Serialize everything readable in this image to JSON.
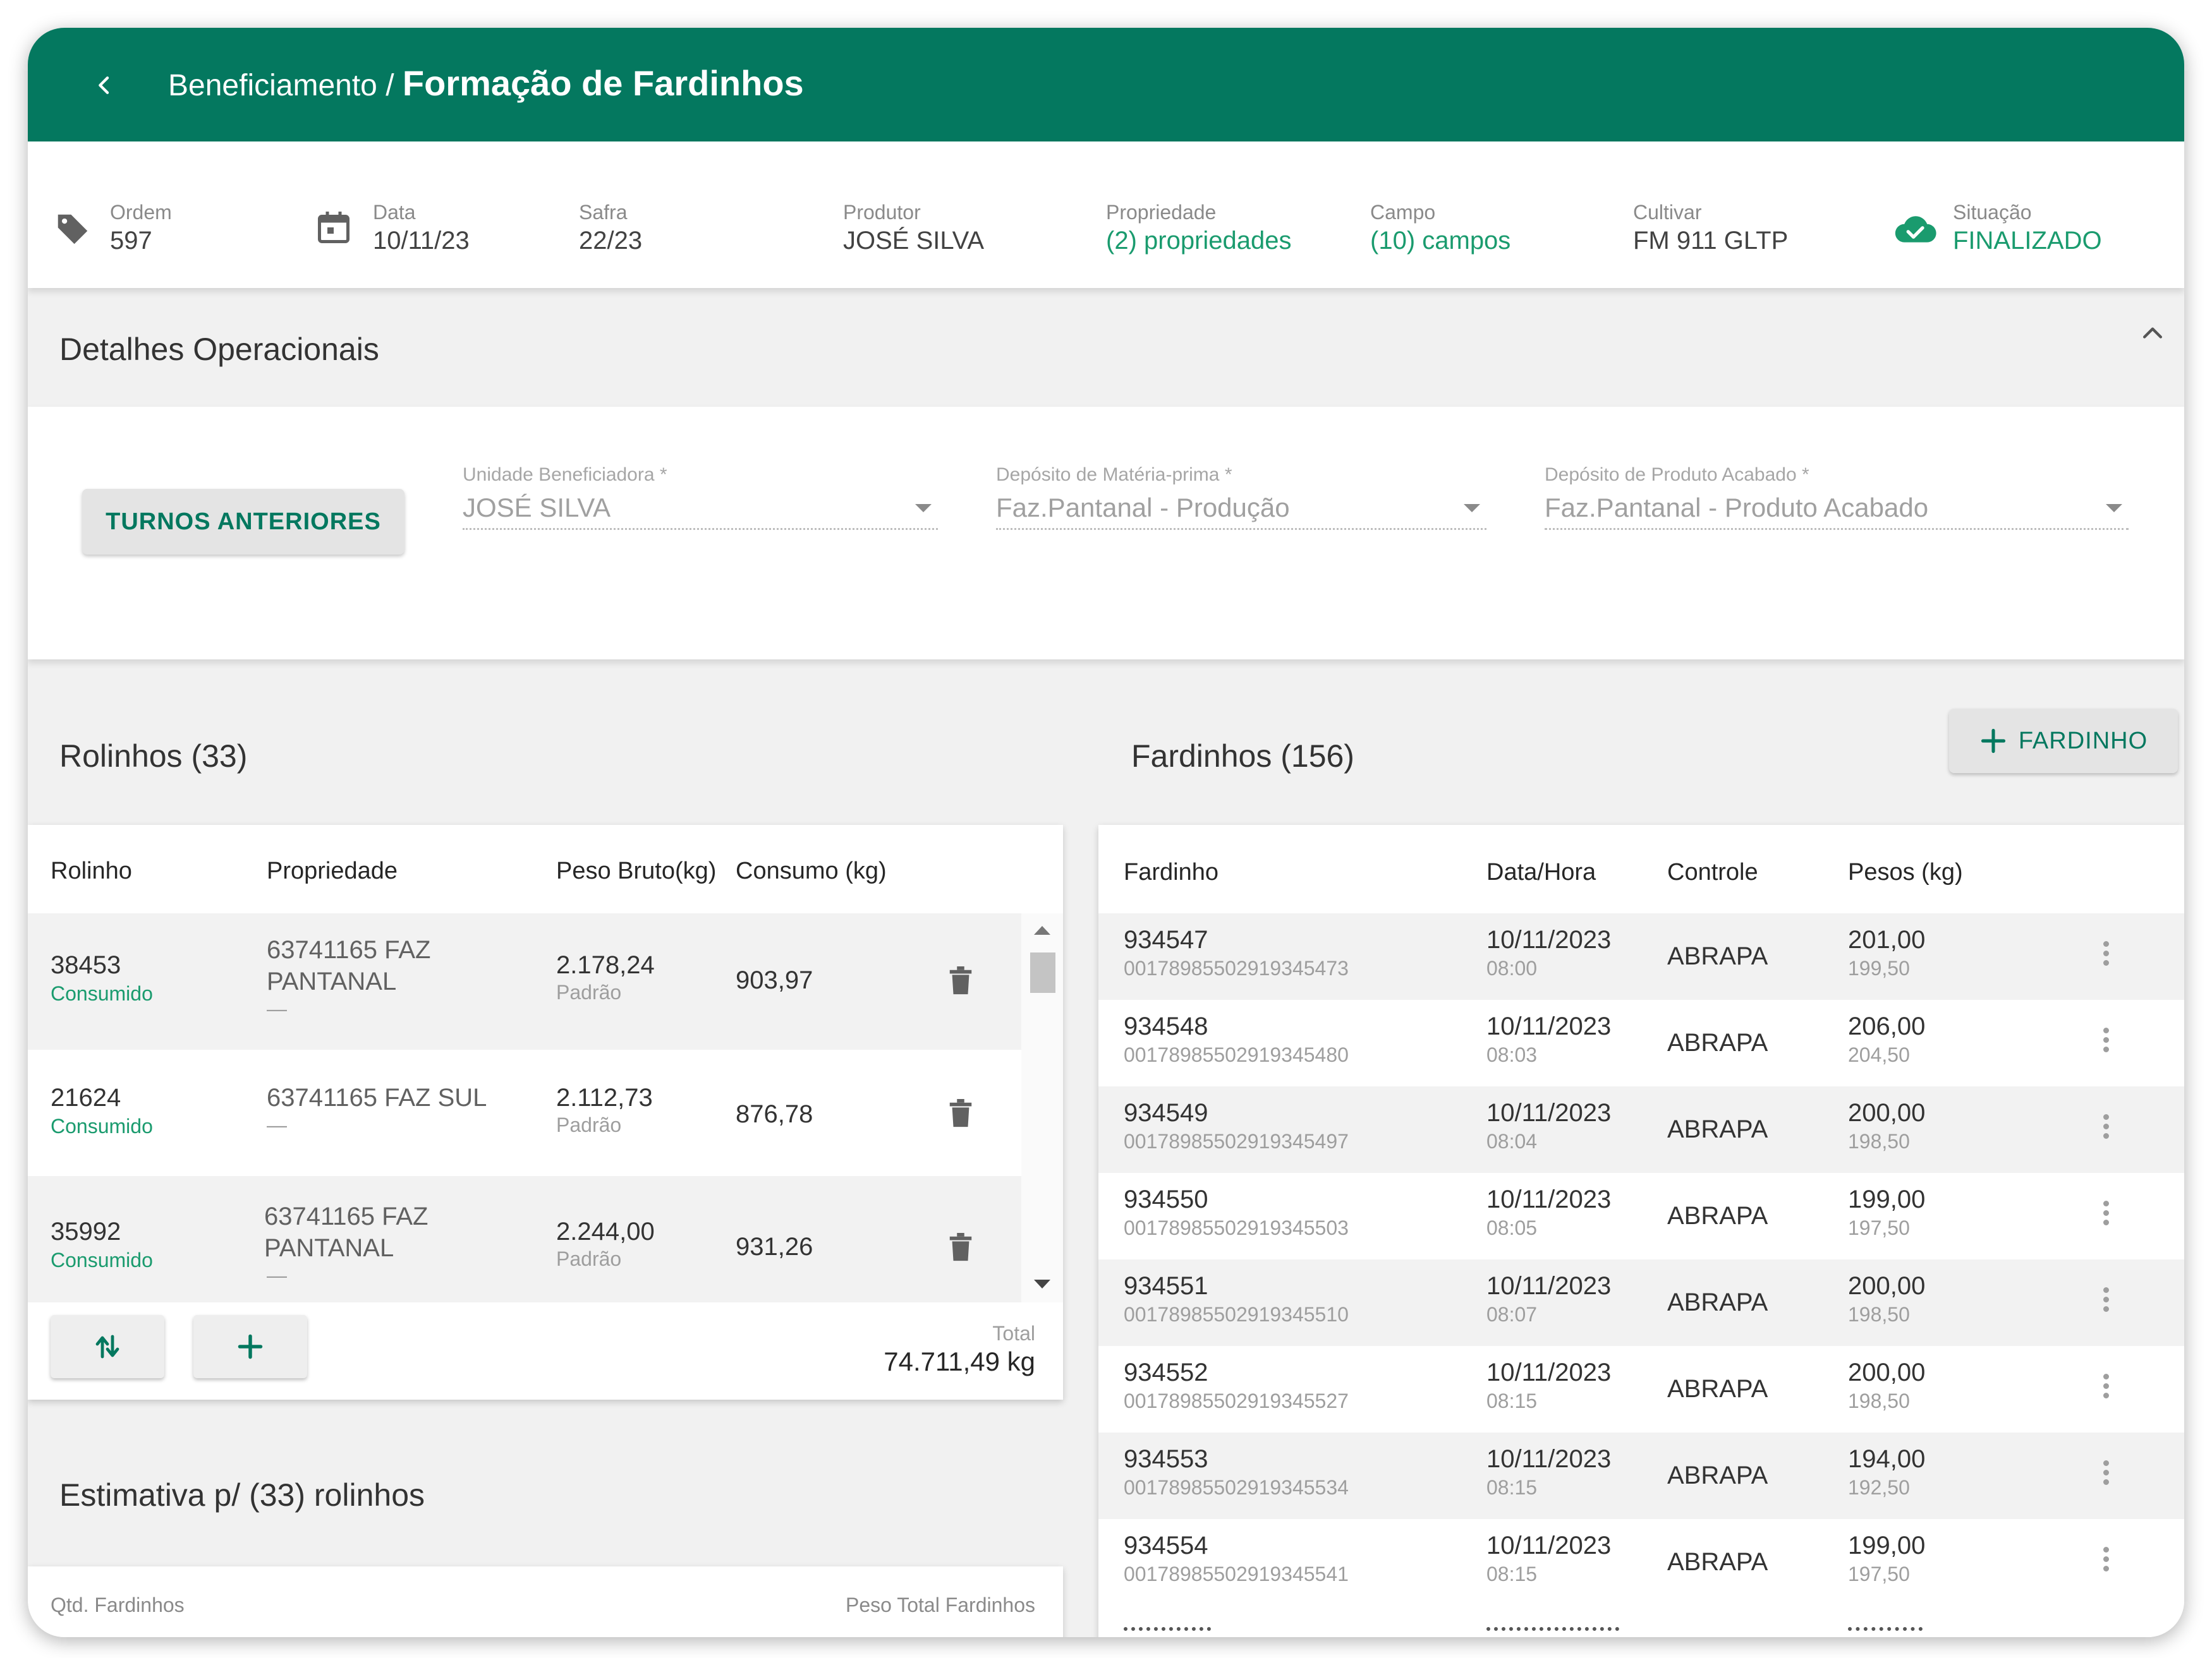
{
  "header": {
    "breadcrumb": "Beneficiamento /",
    "title": "Formação de Fardinhos"
  },
  "info": {
    "ordem": {
      "label": "Ordem",
      "value": "597"
    },
    "data": {
      "label": "Data",
      "value": "10/11/23"
    },
    "safra": {
      "label": "Safra",
      "value": "22/23"
    },
    "produtor": {
      "label": "Produtor",
      "value": "JOSÉ SILVA"
    },
    "propriedade": {
      "label": "Propriedade",
      "value": "(2) propriedades"
    },
    "campo": {
      "label": "Campo",
      "value": "(10) campos"
    },
    "cultivar": {
      "label": "Cultivar",
      "value": "FM 911 GLTP"
    },
    "situacao": {
      "label": "Situação",
      "value": "FINALIZADO"
    }
  },
  "ops": {
    "title": "Detalhes Operacionais",
    "turnos_button": "TURNOS ANTERIORES",
    "unidade": {
      "label": "Unidade Beneficiadora *",
      "value": "JOSÉ SILVA"
    },
    "deposito_mp": {
      "label": "Depósito de Matéria-prima *",
      "value": "Faz.Pantanal - Produção"
    },
    "deposito_pa": {
      "label": "Depósito de Produto Acabado *",
      "value": "Faz.Pantanal - Produto Acabado"
    }
  },
  "rolinhos": {
    "title": "Rolinhos (33)",
    "columns": [
      "Rolinho",
      "Propriedade",
      "Peso Bruto(kg)",
      "Consumo (kg)"
    ],
    "rows": [
      {
        "id": "38453",
        "status": "Consumido",
        "propriedade": "63741165 FAZ",
        "propriedade2": "PANTANAL",
        "extra": "—",
        "peso": "2.178,24",
        "peso_sub": "Padrão",
        "consumo": "903,97"
      },
      {
        "id": "21624",
        "status": "Consumido",
        "propriedade": "63741165 FAZ SUL",
        "propriedade2": "",
        "extra": "—",
        "peso": "2.112,73",
        "peso_sub": "Padrão",
        "consumo": "876,78"
      },
      {
        "id": "35992",
        "status": "Consumido",
        "propriedade": "63741165 FAZ",
        "propriedade2": "PANTANAL",
        "extra": "—",
        "peso": "2.244,00",
        "peso_sub": "Padrão",
        "consumo": "931,26"
      }
    ],
    "total_label": "Total",
    "total_value": "74.711,49 kg"
  },
  "estimativa": {
    "title": "Estimativa p/ (33) rolinhos",
    "qtd_label": "Qtd. Fardinhos",
    "peso_label": "Peso Total Fardinhos"
  },
  "fardinhos": {
    "title": "Fardinhos (156)",
    "add_button": "FARDINHO",
    "columns": [
      "Fardinho",
      "Data/Hora",
      "Controle",
      "Pesos (kg)"
    ],
    "rows": [
      {
        "id": "934547",
        "code": "00178985502919345473",
        "date": "10/11/2023",
        "time": "08:00",
        "controle": "ABRAPA",
        "peso": "201,00",
        "peso_sub": "199,50"
      },
      {
        "id": "934548",
        "code": "00178985502919345480",
        "date": "10/11/2023",
        "time": "08:03",
        "controle": "ABRAPA",
        "peso": "206,00",
        "peso_sub": "204,50"
      },
      {
        "id": "934549",
        "code": "00178985502919345497",
        "date": "10/11/2023",
        "time": "08:04",
        "controle": "ABRAPA",
        "peso": "200,00",
        "peso_sub": "198,50"
      },
      {
        "id": "934550",
        "code": "00178985502919345503",
        "date": "10/11/2023",
        "time": "08:05",
        "controle": "ABRAPA",
        "peso": "199,00",
        "peso_sub": "197,50"
      },
      {
        "id": "934551",
        "code": "00178985502919345510",
        "date": "10/11/2023",
        "time": "08:07",
        "controle": "ABRAPA",
        "peso": "200,00",
        "peso_sub": "198,50"
      },
      {
        "id": "934552",
        "code": "00178985502919345527",
        "date": "10/11/2023",
        "time": "08:15",
        "controle": "ABRAPA",
        "peso": "200,00",
        "peso_sub": "198,50"
      },
      {
        "id": "934553",
        "code": "00178985502919345534",
        "date": "10/11/2023",
        "time": "08:15",
        "controle": "ABRAPA",
        "peso": "194,00",
        "peso_sub": "192,50"
      },
      {
        "id": "934554",
        "code": "00178985502919345541",
        "date": "10/11/2023",
        "time": "08:15",
        "controle": "ABRAPA",
        "peso": "199,00",
        "peso_sub": "197,50"
      }
    ]
  },
  "colors": {
    "brand": "#04785f",
    "accent_green": "#1a9b6e"
  }
}
